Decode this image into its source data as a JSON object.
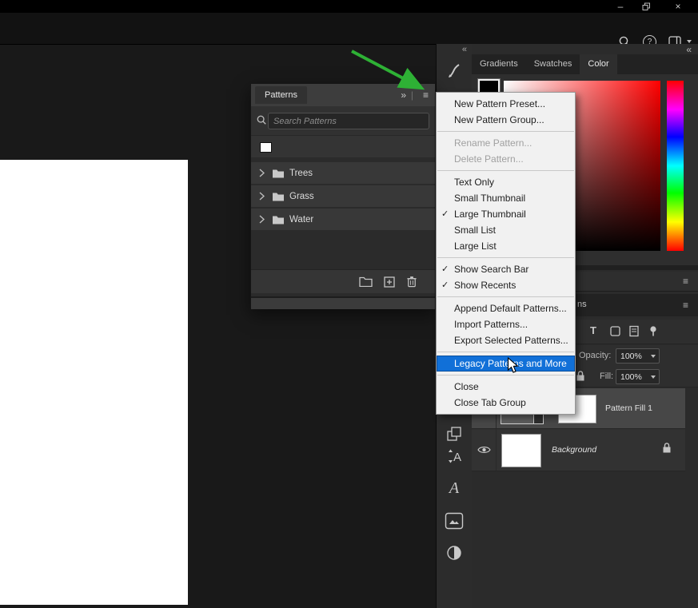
{
  "icons": {
    "minimize": "–",
    "close": "×",
    "help": "?",
    "collapse_left": "«",
    "expand_right": "»",
    "panel_menu": "≡",
    "header_divider": "|"
  },
  "patterns_panel": {
    "tab_label": "Patterns",
    "search_placeholder": "Search Patterns",
    "groups": [
      {
        "label": "Trees"
      },
      {
        "label": "Grass"
      },
      {
        "label": "Water"
      }
    ]
  },
  "context_menu": {
    "items": [
      {
        "label": "New Pattern Preset...",
        "state": "normal"
      },
      {
        "label": "New Pattern Group...",
        "state": "normal"
      },
      {
        "label": "Rename Pattern...",
        "state": "disabled"
      },
      {
        "label": "Delete Pattern...",
        "state": "disabled"
      },
      {
        "label": "Text Only",
        "state": "normal"
      },
      {
        "label": "Small Thumbnail",
        "state": "normal"
      },
      {
        "label": "Large Thumbnail",
        "state": "checked"
      },
      {
        "label": "Small List",
        "state": "normal"
      },
      {
        "label": "Large List",
        "state": "normal"
      },
      {
        "label": "Show Search Bar",
        "state": "checked"
      },
      {
        "label": "Show Recents",
        "state": "checked"
      },
      {
        "label": "Append Default Patterns...",
        "state": "normal"
      },
      {
        "label": "Import Patterns...",
        "state": "normal"
      },
      {
        "label": "Export Selected Patterns...",
        "state": "normal"
      },
      {
        "label": "Legacy Patterns and More",
        "state": "highlighted"
      },
      {
        "label": "Close",
        "state": "normal"
      },
      {
        "label": "Close Tab Group",
        "state": "normal"
      }
    ]
  },
  "right_dock": {
    "tabs": [
      {
        "label": "Gradients"
      },
      {
        "label": "Swatches"
      },
      {
        "label": "Color"
      }
    ],
    "active_tab": "Color",
    "partial_tab_text": "ns",
    "filter_type_label": "T",
    "opacity_label": "Opacity:",
    "opacity_value": "100%",
    "fill_label": "Fill:",
    "fill_value": "100%",
    "layers": [
      {
        "name": "Pattern Fill 1",
        "selected": true
      },
      {
        "name": "Background",
        "locked": true
      }
    ]
  },
  "colors": {
    "menu_highlight": "#1170d8",
    "annotation_green": "#2eb135"
  }
}
